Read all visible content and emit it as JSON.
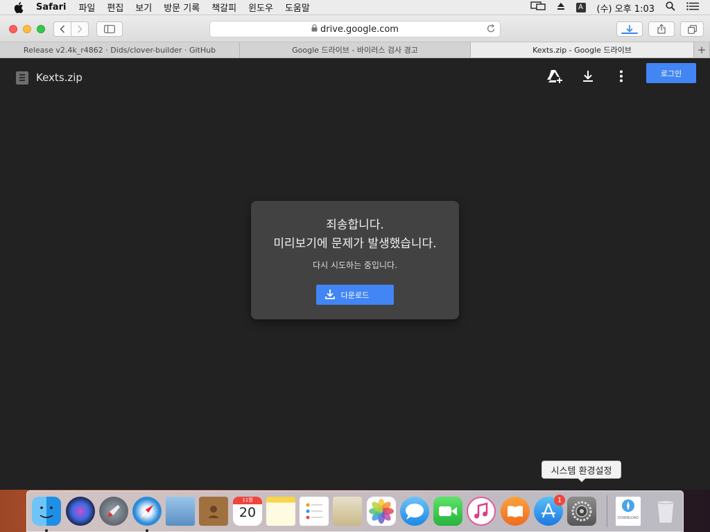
{
  "menubar": {
    "app": "Safari",
    "items": [
      "파일",
      "편집",
      "보기",
      "방문 기록",
      "책갈피",
      "윈도우",
      "도움말"
    ],
    "input_source": "A",
    "clock": "(수) 오후 1:03"
  },
  "browser": {
    "url": "drive.google.com",
    "tabs": [
      {
        "label": "Release v2.4k_r4862 · Dids/clover-builder · GitHub"
      },
      {
        "label": "Google 드라이브 - 바이러스 검사 경고"
      },
      {
        "label": "Kexts.zip - Google 드라이브"
      }
    ],
    "new_tab": "+"
  },
  "viewer": {
    "file_name": "Kexts.zip",
    "login_label": "로그인"
  },
  "dialog": {
    "line1": "죄송합니다.",
    "line2": "미리보기에 문제가 발생했습니다.",
    "subtitle": "다시 시도하는 중입니다.",
    "download_label": "다운로드"
  },
  "dock": {
    "tooltip": "시스템 환경설정",
    "calendar_month": "11월",
    "calendar_day": "20",
    "appstore_badge": "1",
    "download_doc_label": "DOWNLOAD"
  },
  "colors": {
    "accent": "#4285f4",
    "viewer_bg": "#222222",
    "dialog_bg": "#424242"
  }
}
